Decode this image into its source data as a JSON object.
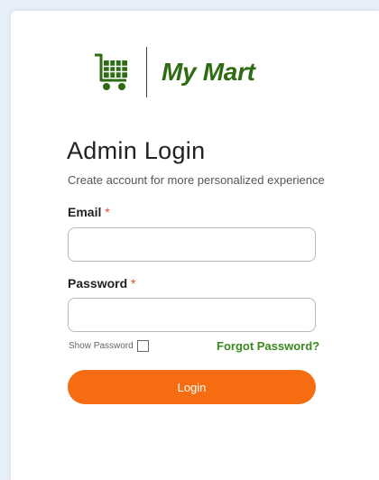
{
  "brand": {
    "name": "My Mart",
    "icon": "cart-icon",
    "color": "#2e6b12"
  },
  "form": {
    "title": "Admin Login",
    "subtitle": "Create account for more personalized experience",
    "email": {
      "label": "Email",
      "required_mark": "*",
      "value": "",
      "placeholder": ""
    },
    "password": {
      "label": "Password",
      "required_mark": "*",
      "value": "",
      "placeholder": ""
    },
    "show_password": {
      "label": "Show Password",
      "checked": false
    },
    "forgot_password": "Forgot Password?",
    "login_button": "Login"
  },
  "colors": {
    "accent": "#f56d10",
    "link": "#3a8a1e",
    "required": "#e24a2e",
    "page_background": "#e8eff8"
  }
}
